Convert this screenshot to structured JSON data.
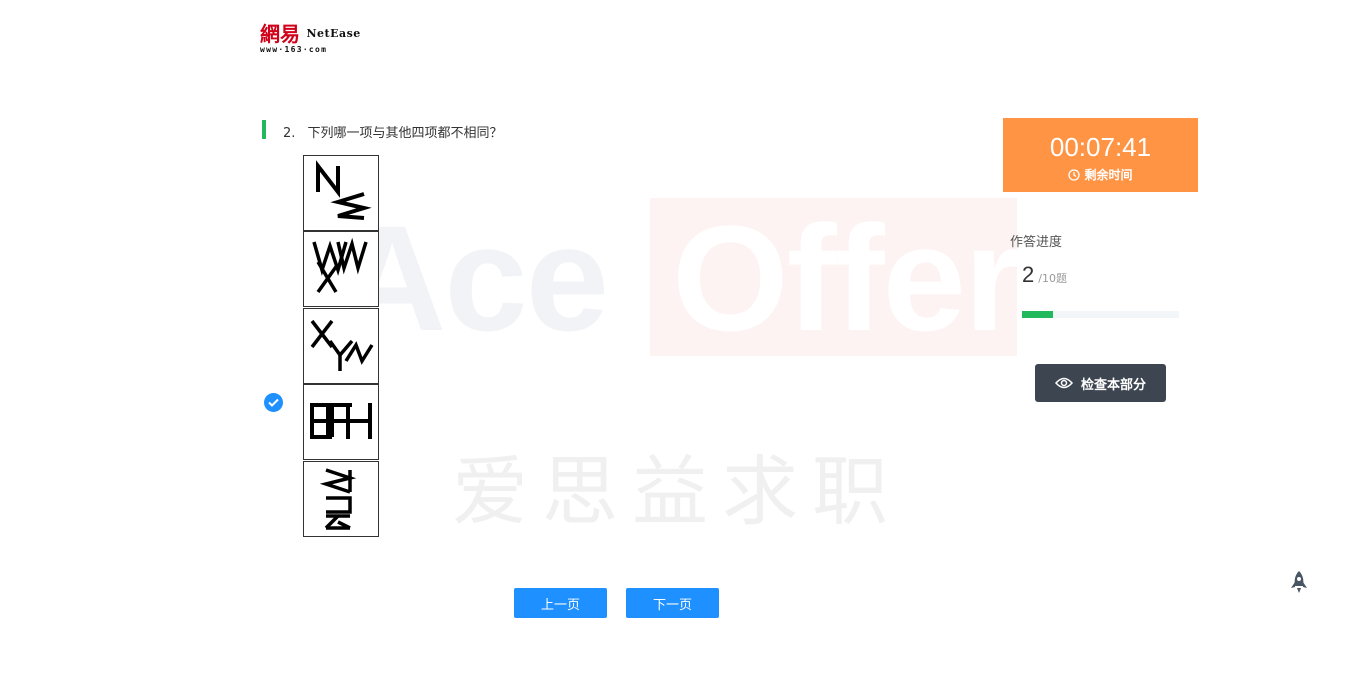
{
  "brand": {
    "logo_cn": "網易",
    "logo_en": "NetEase",
    "logo_url": "www·163·com"
  },
  "watermark": {
    "ace": "Ace",
    "offer": "Offer",
    "cn": "爱思益求职"
  },
  "question": {
    "number": "2.",
    "text": "下列哪一项与其他四项都不相同？",
    "selected_option_index": 4,
    "options": [
      {
        "label": "option-1"
      },
      {
        "label": "option-2"
      },
      {
        "label": "option-3"
      },
      {
        "label": "option-4"
      },
      {
        "label": "option-5"
      }
    ]
  },
  "timer": {
    "value": "00:07:41",
    "label": "剩余时间",
    "color": "#ff9445"
  },
  "progress": {
    "title": "作答进度",
    "current": "2",
    "total": "/10题",
    "fraction": 0.2
  },
  "review_button": {
    "label": "检查本部分",
    "icon": "eye-icon"
  },
  "pager": {
    "prev": "上一页",
    "next": "下一页"
  },
  "colors": {
    "accent_blue": "#1e90ff",
    "accent_green": "#21b95c",
    "dark_button": "#3d4550"
  },
  "back_to_top_icon": "rocket-icon"
}
